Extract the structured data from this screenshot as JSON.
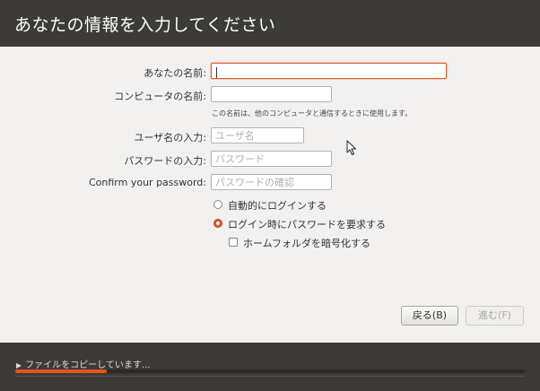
{
  "header": {
    "title": "あなたの情報を入力してください"
  },
  "form": {
    "your_name": {
      "label": "あなたの名前:",
      "value": ""
    },
    "computer_name": {
      "label": "コンピュータの名前:",
      "value": "",
      "hint": "この名前は、他のコンピュータと通信するときに使用します。"
    },
    "username": {
      "label": "ユーザ名の入力:",
      "placeholder": "ユーザ名"
    },
    "password": {
      "label": "パスワードの入力:",
      "placeholder": "パスワード"
    },
    "confirm_password": {
      "label": "Confirm your password:",
      "placeholder": "パスワードの確認"
    },
    "login_options": [
      {
        "label": "自動的にログインする",
        "selected": false
      },
      {
        "label": "ログイン時にパスワードを要求する",
        "selected": true
      }
    ],
    "encrypt_home": {
      "label": "ホームフォルダを暗号化する",
      "checked": false
    }
  },
  "buttons": {
    "back": "戻る(B)",
    "forward": "進む(F)"
  },
  "footer": {
    "expander_icon": "triangle-right-icon",
    "status": "ファイルをコピーしています...",
    "progress_fraction": 0.18
  },
  "colors": {
    "accent": "#e9541f",
    "header_bg": "#3c3b37",
    "body_bg": "#f2f1f0"
  }
}
